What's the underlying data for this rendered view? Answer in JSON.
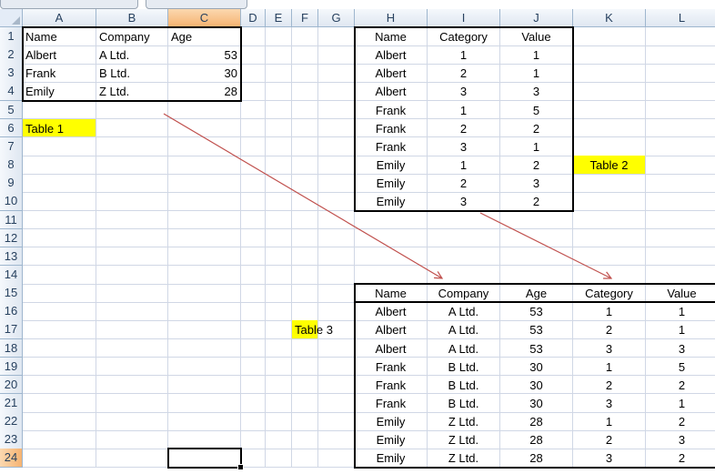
{
  "columns": [
    "A",
    "B",
    "C",
    "D",
    "E",
    "F",
    "G",
    "H",
    "I",
    "J",
    "K",
    "L"
  ],
  "rows": [
    "1",
    "2",
    "3",
    "4",
    "5",
    "6",
    "7",
    "8",
    "9",
    "10",
    "11",
    "12",
    "13",
    "14",
    "15",
    "16",
    "17",
    "18",
    "19",
    "20",
    "21",
    "22",
    "23",
    "24"
  ],
  "cells": {
    "A1": "Name",
    "B1": "Company",
    "C1": "Age",
    "A2": "Albert",
    "B2": "A Ltd.",
    "C2": "53",
    "A3": "Frank",
    "B3": "B Ltd.",
    "C3": "30",
    "A4": "Emily",
    "B4": "Z Ltd.",
    "C4": "28",
    "A6": "Table 1",
    "H1": "Name",
    "I1": "Category",
    "J1": "Value",
    "H2": "Albert",
    "I2": "1",
    "J2": "1",
    "H3": "Albert",
    "I3": "2",
    "J3": "1",
    "H4": "Albert",
    "I4": "3",
    "J4": "3",
    "H5": "Frank",
    "I5": "1",
    "J5": "5",
    "H6": "Frank",
    "I6": "2",
    "J6": "2",
    "H7": "Frank",
    "I7": "3",
    "J7": "1",
    "H8": "Emily",
    "I8": "1",
    "J8": "2",
    "H9": "Emily",
    "I9": "2",
    "J9": "3",
    "H10": "Emily",
    "I10": "3",
    "J10": "2",
    "K8": "Table 2",
    "F17": "Table 3",
    "H15": "Name",
    "I15": "Company",
    "J15": "Age",
    "K15": "Category",
    "L15": "Value",
    "H16": "Albert",
    "I16": "A Ltd.",
    "J16": "53",
    "K16": "1",
    "L16": "1",
    "H17": "Albert",
    "I17": "A Ltd.",
    "J17": "53",
    "K17": "2",
    "L17": "1",
    "H18": "Albert",
    "I18": "A Ltd.",
    "J18": "53",
    "K18": "3",
    "L18": "3",
    "H19": "Frank",
    "I19": "B Ltd.",
    "J19": "30",
    "K19": "1",
    "L19": "5",
    "H20": "Frank",
    "I20": "B Ltd.",
    "J20": "30",
    "K20": "2",
    "L20": "2",
    "H21": "Frank",
    "I21": "B Ltd.",
    "J21": "30",
    "K21": "3",
    "L21": "1",
    "H22": "Emily",
    "I22": "Z Ltd.",
    "J22": "28",
    "K22": "1",
    "L22": "2",
    "H23": "Emily",
    "I23": "Z Ltd.",
    "J23": "28",
    "K23": "2",
    "L23": "3",
    "H24": "Emily",
    "I24": "Z Ltd.",
    "J24": "28",
    "K24": "3",
    "L24": "2"
  },
  "highlighted_cells": [
    "A6",
    "K8",
    "F17"
  ],
  "selected_cell": "C24",
  "colors": {
    "highlight": "#ffff00",
    "arrow": "#c0504d",
    "selected_header": "#f6b371",
    "header": "#dfe7f1",
    "gridline": "#d0d7e5"
  }
}
